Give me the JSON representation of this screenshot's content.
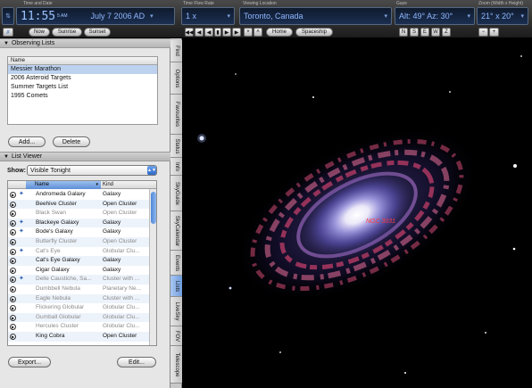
{
  "toolbar": {
    "time_label": "Time and Date",
    "clock": "11:55",
    "ampm": "5 AM",
    "date": "July  7  2006 AD",
    "flow_label": "Time Flow Rate",
    "flow_value": "1 x",
    "location_label": "Viewing Location",
    "location_value": "Toronto, Canada",
    "gaze_label": "Gaze",
    "gaze_value": "Alt: 49° Az: 30°",
    "zoom_label": "Zoom (Width x Height)",
    "zoom_value": "21° x 20°",
    "now_btn": "Now",
    "sunrise_btn": "Sunrise",
    "sunset_btn": "Sunset",
    "home_btn": "Home",
    "spaceship_btn": "Spaceship",
    "dir_n": "N",
    "dir_s": "S",
    "dir_e": "E",
    "dir_w": "W",
    "dir_z": "Z"
  },
  "observing": {
    "header": "Observing Lists",
    "col_name": "Name",
    "lists": [
      "Messier Marathon",
      "2006 Asteroid Targets",
      "Summer Targets List",
      "1995 Comets"
    ],
    "add_btn": "Add...",
    "delete_btn": "Delete"
  },
  "viewer": {
    "header": "List Viewer",
    "show_label": "Show:",
    "show_value": "Visible Tonight",
    "col_name": "Name",
    "col_kind": "Kind",
    "rows": [
      {
        "name": "Andromeda Galaxy",
        "kind": "Galaxy",
        "starred": true,
        "visible": true
      },
      {
        "name": "Beehive Cluster",
        "kind": "Open Cluster",
        "starred": false,
        "visible": true
      },
      {
        "name": "Black Swan",
        "kind": "Open Cluster",
        "starred": false,
        "visible": false
      },
      {
        "name": "Blackeye Galaxy",
        "kind": "Galaxy",
        "starred": true,
        "visible": true
      },
      {
        "name": "Bode's Galaxy",
        "kind": "Galaxy",
        "starred": true,
        "visible": true
      },
      {
        "name": "Butterfly Cluster",
        "kind": "Open Cluster",
        "starred": false,
        "visible": false
      },
      {
        "name": "Cat's Eye",
        "kind": "Globular Clu...",
        "starred": true,
        "visible": false
      },
      {
        "name": "Cat's Eye Galaxy",
        "kind": "Galaxy",
        "starred": false,
        "visible": true
      },
      {
        "name": "Cigar Galaxy",
        "kind": "Galaxy",
        "starred": false,
        "visible": true
      },
      {
        "name": "Delle Caustiche, Sa...",
        "kind": "Cluster with ...",
        "starred": true,
        "visible": false
      },
      {
        "name": "Dumbbell Nebula",
        "kind": "Planetary Ne...",
        "starred": false,
        "visible": false
      },
      {
        "name": "Eagle Nebula",
        "kind": "Cluster with ...",
        "starred": false,
        "visible": false
      },
      {
        "name": "Flickering Globular",
        "kind": "Globular Clu...",
        "starred": false,
        "visible": false
      },
      {
        "name": "Gumball Globular",
        "kind": "Globular Clu...",
        "starred": false,
        "visible": false
      },
      {
        "name": "Hercules Cluster",
        "kind": "Globular Clu...",
        "starred": false,
        "visible": false
      },
      {
        "name": "King Cobra",
        "kind": "Open Cluster",
        "starred": false,
        "visible": true
      }
    ],
    "export_btn": "Export...",
    "edit_btn": "Edit..."
  },
  "tabs": [
    "Find",
    "Options",
    "Favourites",
    "Status",
    "Info",
    "SkyGuide",
    "SkyCalendar",
    "Events",
    "Lists",
    "LiveSky",
    "FOV",
    "Telescope"
  ],
  "active_tab": "Lists",
  "sky": {
    "object_label": "NGC 3031"
  },
  "colors": {
    "label_red": "#ff3b3b",
    "accent_blue": "#6f9ddd"
  }
}
